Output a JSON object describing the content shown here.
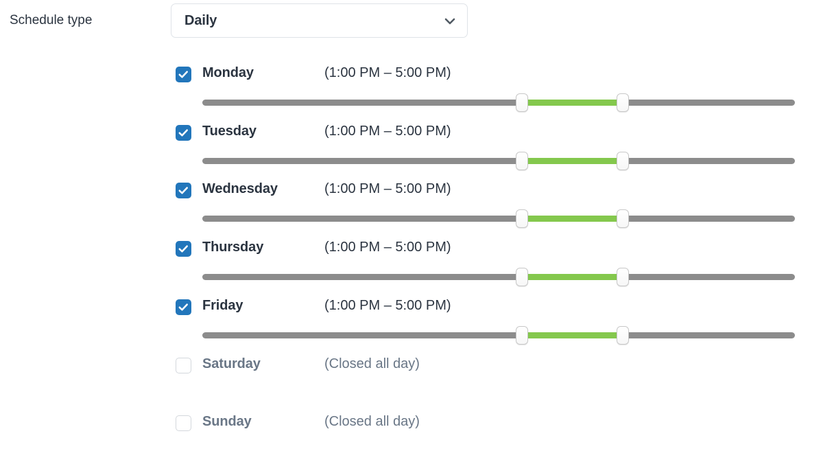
{
  "form": {
    "schedule_type_label": "Schedule type",
    "schedule_type_value": "Daily",
    "chevron_icon": "chevron-down-icon"
  },
  "slider": {
    "track_color": "#8c8c8c",
    "fill_color": "#84c84d",
    "handle_color": "#ffffff",
    "range_start_pct": 53.9,
    "range_end_pct": 71.0
  },
  "colors": {
    "checkbox_checked": "#2276bb",
    "checkbox_unchecked_border": "#d3d7dc",
    "text_active": "#2b3440",
    "text_inactive": "#697686",
    "background": "#ffffff"
  },
  "days": [
    {
      "name": "Monday",
      "checked": true,
      "time_text": "(1:00 PM – 5:00 PM)",
      "has_slider": true,
      "start_pct": 53.9,
      "end_pct": 71.0
    },
    {
      "name": "Tuesday",
      "checked": true,
      "time_text": "(1:00 PM – 5:00 PM)",
      "has_slider": true,
      "start_pct": 53.9,
      "end_pct": 71.0
    },
    {
      "name": "Wednesday",
      "checked": true,
      "time_text": "(1:00 PM – 5:00 PM)",
      "has_slider": true,
      "start_pct": 53.9,
      "end_pct": 71.0
    },
    {
      "name": "Thursday",
      "checked": true,
      "time_text": "(1:00 PM – 5:00 PM)",
      "has_slider": true,
      "start_pct": 53.9,
      "end_pct": 71.0
    },
    {
      "name": "Friday",
      "checked": true,
      "time_text": "(1:00 PM – 5:00 PM)",
      "has_slider": true,
      "start_pct": 53.9,
      "end_pct": 71.0
    },
    {
      "name": "Saturday",
      "checked": false,
      "time_text": "(Closed all day)",
      "has_slider": false
    },
    {
      "name": "Sunday",
      "checked": false,
      "time_text": "(Closed all day)",
      "has_slider": false
    }
  ]
}
